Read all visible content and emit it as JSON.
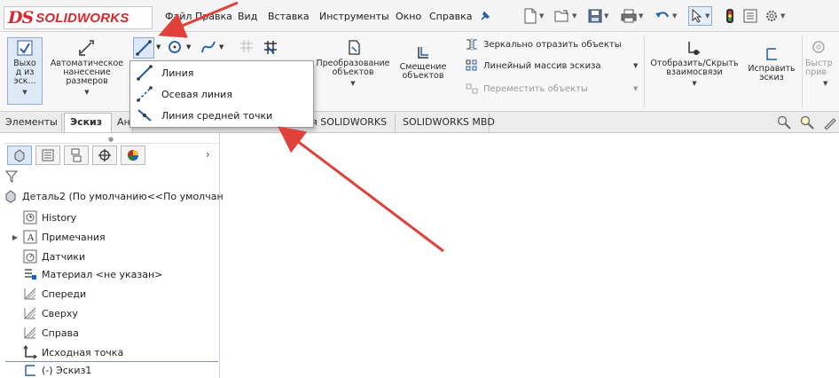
{
  "app": {
    "logo_text": "SOLIDWORKS",
    "logo_mark": "DS",
    "brand_color": "#d7262d"
  },
  "menu": {
    "items": [
      "Файл",
      "Правка",
      "Вид",
      "Вставка",
      "Инструменты",
      "Окно",
      "Справка"
    ],
    "pin_icon": "pin-icon"
  },
  "quick_access": [
    "new-document-icon",
    "open-icon",
    "save-icon",
    "print-icon",
    "undo-icon",
    "select-icon",
    "rebuild-icon",
    "file-properties-icon",
    "options-icon"
  ],
  "ribbon": {
    "exit_sketch": "Выхо\nд из\nэск...",
    "smart_dimension": "Автоматическое\nнанесение\nразмеров",
    "transform": "Преобразование\nобъектов",
    "offset": "Смещение\nобъектов",
    "mirror": "Зеркально отразить объекты",
    "linear_pattern": "Линейный массив эскиза",
    "move": "Переместить объекты",
    "show_relations": "Отобразить/Скрыть\nвзаимосвязи",
    "repair": "Исправить\nэскиз",
    "quick_snaps": "Быстр\nприв"
  },
  "flyout": {
    "items": [
      {
        "label": "Линия",
        "icon": "line-icon"
      },
      {
        "label": "Осевая линия",
        "icon": "centerline-icon"
      },
      {
        "label": "Линия средней точки",
        "icon": "midpoint-line-icon"
      }
    ]
  },
  "tabs": {
    "items": [
      "Элементы",
      "Эскиз",
      "Ан",
      "ия SOLIDWORKS",
      "SOLIDWORKS MBD"
    ],
    "active": "Эскиз"
  },
  "feature_tree": {
    "root": "Деталь2  (По умолчанию<<По умолчан",
    "items": [
      {
        "label": "History",
        "icon": "history-icon"
      },
      {
        "label": "Примечания",
        "icon": "annotations-icon"
      },
      {
        "label": "Датчики",
        "icon": "sensors-icon"
      },
      {
        "label": "Материал <не указан>",
        "icon": "material-icon"
      },
      {
        "label": "Спереди",
        "icon": "plane-icon"
      },
      {
        "label": "Сверху",
        "icon": "plane-icon"
      },
      {
        "label": "Справа",
        "icon": "plane-icon"
      },
      {
        "label": "Исходная точка",
        "icon": "origin-icon"
      },
      {
        "label": "(-) Эскиз1",
        "icon": "sketch-icon"
      }
    ]
  },
  "annotation_color": "#e0413a"
}
